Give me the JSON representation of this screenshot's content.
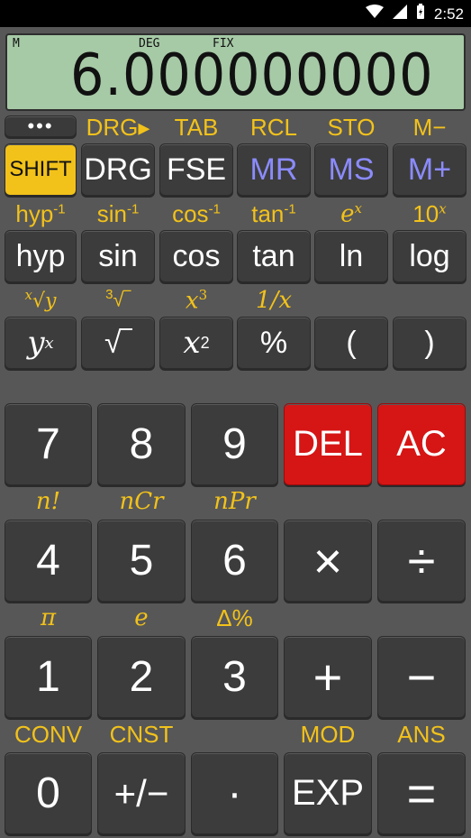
{
  "status_bar": {
    "time": "2:52",
    "icons": [
      "wifi-icon",
      "signal-icon",
      "battery-icon"
    ]
  },
  "display": {
    "memory_indicator": "M",
    "angle_mode": "DEG",
    "format_mode": "FIX",
    "value": "6.000000000"
  },
  "row1_labels": [
    "DRG▸",
    "TAB",
    "RCL",
    "STO",
    "M−"
  ],
  "row1_keys": [
    "SHIFT",
    "DRG",
    "FSE",
    "MR",
    "MS",
    "M+"
  ],
  "menu_key": "•••",
  "row2_labels": [
    "hyp",
    "-1",
    "sin",
    "-1",
    "cos",
    "-1",
    "tan",
    "-1",
    "e",
    "x",
    "10",
    "x"
  ],
  "row2_keys": [
    "hyp",
    "sin",
    "cos",
    "tan",
    "ln",
    "log"
  ],
  "row3_labels": [
    "x",
    "√y",
    "3",
    "√‾",
    "x",
    "3",
    "1/x"
  ],
  "row3_keys": [
    "y",
    "x",
    "√‾",
    "x",
    "2",
    "%",
    "(",
    ")"
  ],
  "num_row1": [
    "7",
    "8",
    "9",
    "DEL",
    "AC"
  ],
  "num_row2_labels": [
    "n!",
    "nCr",
    "nPr"
  ],
  "num_row2": [
    "4",
    "5",
    "6",
    "×",
    "÷"
  ],
  "num_row3_labels": [
    "π",
    "e",
    "Δ%"
  ],
  "num_row3": [
    "1",
    "2",
    "3",
    "+",
    "−"
  ],
  "num_row4_labels": [
    "CONV",
    "CNST",
    "MOD",
    "ANS"
  ],
  "num_row4": [
    "0",
    "+/−",
    "·",
    "EXP",
    "="
  ],
  "colors": {
    "accent": "#f2c21b",
    "danger": "#d61515",
    "memory_key": "#8b8bff",
    "display_bg": "#a6c9a6",
    "body_bg": "#575757"
  }
}
